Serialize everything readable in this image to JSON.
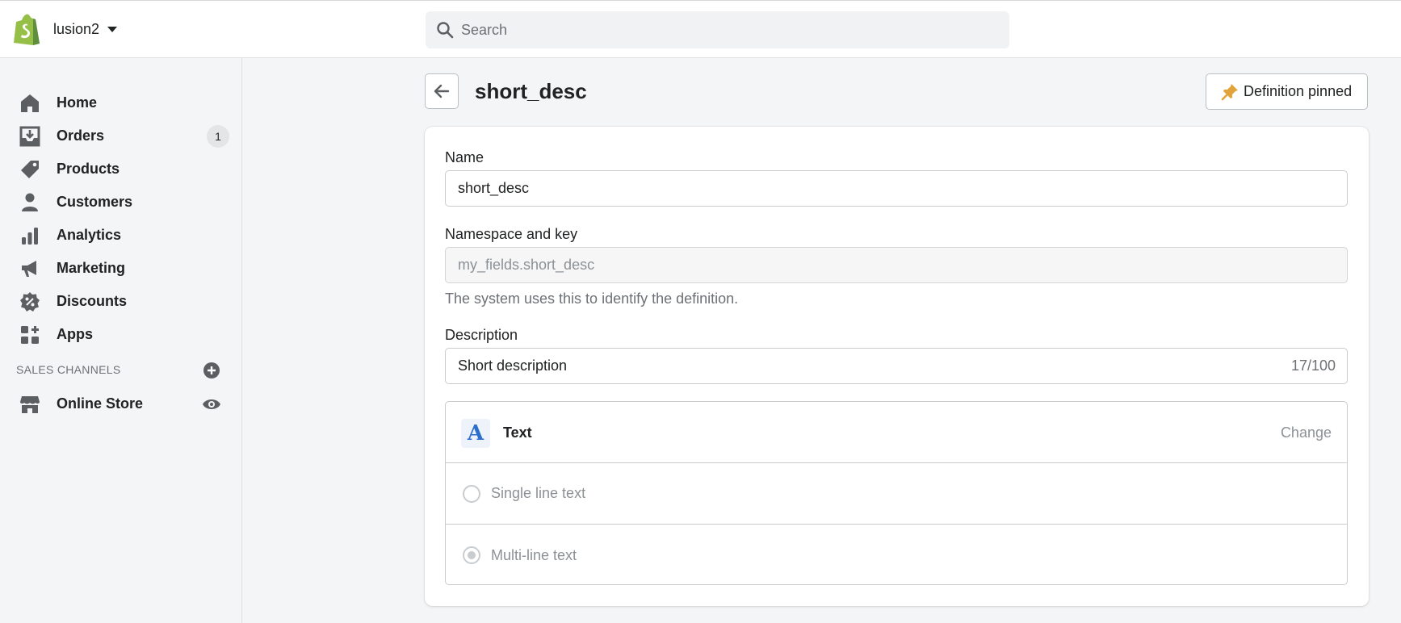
{
  "store": {
    "name": "lusion2"
  },
  "search": {
    "placeholder": "Search"
  },
  "sidebar": {
    "items": [
      {
        "label": "Home",
        "icon": "home-icon"
      },
      {
        "label": "Orders",
        "icon": "orders-icon",
        "badge": "1"
      },
      {
        "label": "Products",
        "icon": "tag-icon"
      },
      {
        "label": "Customers",
        "icon": "person-icon"
      },
      {
        "label": "Analytics",
        "icon": "bar-chart-icon"
      },
      {
        "label": "Marketing",
        "icon": "megaphone-icon"
      },
      {
        "label": "Discounts",
        "icon": "discount-icon"
      },
      {
        "label": "Apps",
        "icon": "apps-icon"
      }
    ],
    "sales_channels_title": "SALES CHANNELS",
    "channels": [
      {
        "label": "Online Store",
        "icon": "store-icon"
      }
    ]
  },
  "header": {
    "title": "short_desc",
    "pin_label": "Definition pinned"
  },
  "form": {
    "name_label": "Name",
    "name_value": "short_desc",
    "namespace_label": "Namespace and key",
    "namespace_value": "my_fields.short_desc",
    "namespace_help": "The system uses this to identify the definition.",
    "description_label": "Description",
    "description_value": "Short description",
    "description_counter": "17/100",
    "type": {
      "name": "Text",
      "icon_glyph": "A",
      "change_label": "Change",
      "options": [
        {
          "label": "Single line text",
          "selected": false
        },
        {
          "label": "Multi-line text",
          "selected": true
        }
      ]
    }
  },
  "colors": {
    "brand": "#95bf47",
    "accent": "#2c6ecb",
    "pin": "#e1a33b"
  }
}
